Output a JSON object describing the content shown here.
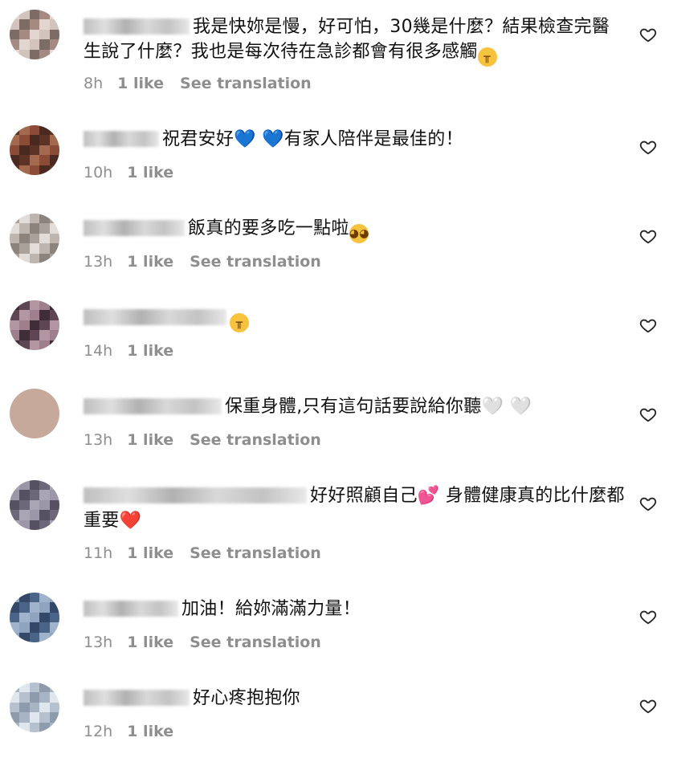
{
  "comments": [
    {
      "username": "",
      "text_before": "我是快妳是慢，好可怕，30幾是什麼？結果檢查完醫生說了什麼？我也是每次待在急診都會有很多感觸",
      "emoji_after": "😢",
      "time": "8h",
      "likes": "1 like",
      "translate": "See translation"
    },
    {
      "username": "",
      "text_before": "祝君安好",
      "emoji_mid": "💙 💙",
      "text_after": "有家人陪伴是最佳的！",
      "time": "10h",
      "likes": "1 like"
    },
    {
      "username": "",
      "text_before": "飯真的要多吃一點啦",
      "emoji_after": "🥺",
      "time": "13h",
      "likes": "1 like",
      "translate": "See translation"
    },
    {
      "username": "",
      "emoji_after": "😢",
      "time": "14h",
      "likes": "1 like"
    },
    {
      "username": "",
      "text_before": "保重身體,只有這句話要說給你聽",
      "emoji_after": "🤍 🤍",
      "time": "13h",
      "likes": "1 like",
      "translate": "See translation"
    },
    {
      "username": "",
      "text_before": "好好照顧自己",
      "emoji_mid": "💕",
      "text_after": " 身體健康真的比什麼都重要",
      "emoji_after": "❤️",
      "time": "11h",
      "likes": "1 like",
      "translate": "See translation"
    },
    {
      "username": "",
      "text_before": "加油！給妳滿滿力量！",
      "time": "13h",
      "likes": "1 like",
      "translate": "See translation"
    },
    {
      "username": "",
      "text_before": "好心疼抱抱你",
      "time": "12h",
      "likes": "1 like"
    }
  ],
  "icons": {
    "like": "heart-outline-icon"
  }
}
